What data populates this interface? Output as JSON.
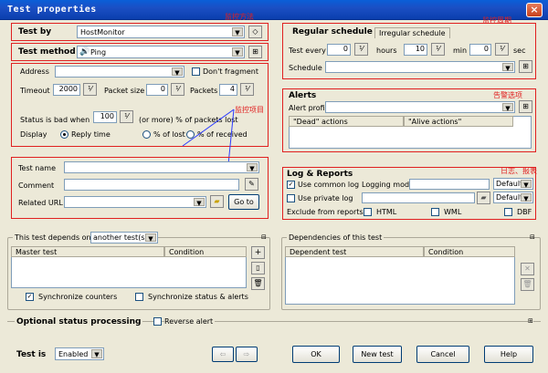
{
  "window": {
    "title": "Test properties",
    "close_label": "×"
  },
  "test_by": {
    "label": "Test by",
    "value": "HostMonitor",
    "note": "监控方法"
  },
  "test_method": {
    "label": "Test method",
    "value": "Ping",
    "icon": "speaker-icon"
  },
  "address": {
    "label": "Address",
    "value": "",
    "dont_fragment": "Don't fragment"
  },
  "timeout": {
    "label": "Timeout",
    "value": "2000",
    "packet_size_label": "Packet size",
    "packet_size_value": "0",
    "packets_label": "Packets",
    "packets_value": "4"
  },
  "status_bad": {
    "label": "Status is bad when",
    "value": "100",
    "suffix": "(or more) % of packets lost"
  },
  "display": {
    "label": "Display",
    "options": [
      "Reply time",
      "% of lost",
      "% of received"
    ],
    "selected": "Reply time"
  },
  "notes": {
    "monitor_item": "监控项目",
    "period": "监控周期",
    "alert": "告警选项",
    "log": "日志、报表"
  },
  "test_name": {
    "label": "Test name",
    "value": ""
  },
  "comment": {
    "label": "Comment",
    "value": ""
  },
  "related_url": {
    "label": "Related URL",
    "value": "",
    "goto": "Go to"
  },
  "schedule": {
    "tab_regular": "Regular schedule",
    "tab_irregular": "Irregular schedule",
    "test_every": "Test every",
    "hours_value": "0",
    "hours_label": "hours",
    "min_value": "10",
    "min_label": "min",
    "sec_value": "0",
    "sec_label": "sec",
    "schedule_label": "Schedule",
    "schedule_value": ""
  },
  "alerts": {
    "title": "Alerts",
    "profile_label": "Alert profile",
    "profile_value": "",
    "col_dead": "\"Dead\" actions",
    "col_alive": "\"Alive actions\""
  },
  "log": {
    "title": "Log & Reports",
    "use_common": "Use common log",
    "logging_mode": "Logging mode",
    "mode_common": "Default",
    "use_private": "Use private log",
    "mode_private": "Default",
    "exclude": "Exclude from reports:",
    "html": "HTML",
    "wml": "WML",
    "dbf": "DBF"
  },
  "depends": {
    "label": "This test depends on",
    "value": "another test(s)",
    "col_master": "Master test",
    "col_condition": "Condition",
    "sync_counters": "Synchronize counters",
    "sync_status": "Synchronize status & alerts"
  },
  "dependencies": {
    "title": "Dependencies of this test",
    "col_dependent": "Dependent test",
    "col_condition": "Condition"
  },
  "optional": {
    "label": "Optional status processing",
    "reverse": "Reverse alert"
  },
  "footer": {
    "test_is": "Test is",
    "state": "Enabled",
    "ok": "OK",
    "new_test": "New test",
    "cancel": "Cancel",
    "help": "Help"
  }
}
